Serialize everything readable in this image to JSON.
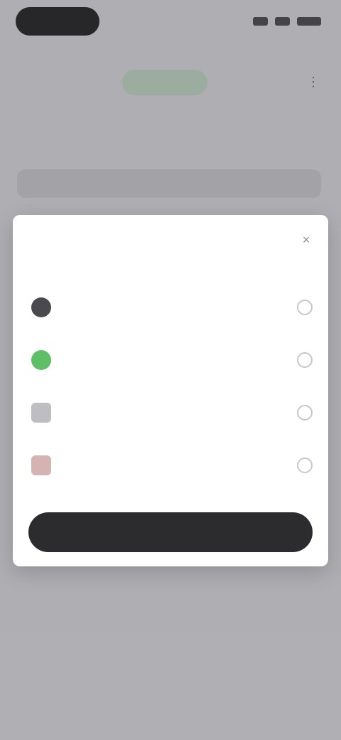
{
  "status_bar": {},
  "header": {},
  "sheet": {
    "options": [
      {
        "icon": "dark-circle-icon"
      },
      {
        "icon": "green-circle-icon"
      },
      {
        "icon": "document-icon"
      },
      {
        "icon": "document-rose-icon"
      }
    ]
  },
  "colors": {
    "backdrop": "#ededf0",
    "sheet": "#ffffff",
    "primary_button": "#2c2c2e",
    "accent_green": "#5fbf67"
  }
}
